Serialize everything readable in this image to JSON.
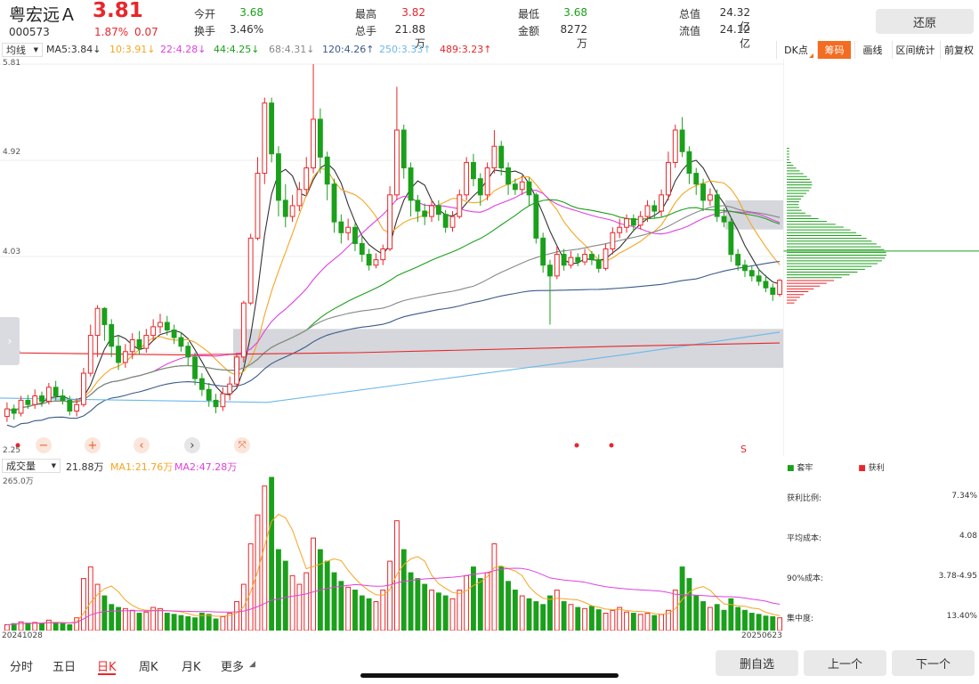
{
  "header": {
    "name": "粤宏远Ａ",
    "price": "3.81",
    "code": "000573",
    "pct": "1.87%",
    "chg": "0.07",
    "stats": [
      {
        "label": "今开",
        "value": "3.68",
        "color": "green"
      },
      {
        "label": "最高",
        "value": "3.82",
        "color": "red"
      },
      {
        "label": "最低",
        "value": "3.68",
        "color": "green"
      },
      {
        "label": "总值",
        "value": "24.32亿",
        "color": "dark"
      },
      {
        "label": "换手",
        "value": "3.46%",
        "color": "dark"
      },
      {
        "label": "总手",
        "value": "21.88万",
        "color": "dark"
      },
      {
        "label": "金额",
        "value": "8272万",
        "color": "dark"
      },
      {
        "label": "流值",
        "value": "24.12亿",
        "color": "dark"
      }
    ],
    "restore_button": "还原"
  },
  "ma_bar": {
    "selector": "均线",
    "items": [
      {
        "text": "MA5:3.84↓",
        "color": "#333333"
      },
      {
        "text": "10:3.91↓",
        "color": "#f5a623"
      },
      {
        "text": "22:4.28↓",
        "color": "#e040e0"
      },
      {
        "text": "44:4.25↓",
        "color": "#1aa01a"
      },
      {
        "text": "68:4.31↓",
        "color": "#888888"
      },
      {
        "text": "120:4.26↑",
        "color": "#3b5a8a"
      },
      {
        "text": "250:3.33↑",
        "color": "#6cb8ea"
      },
      {
        "text": "489:3.23↑",
        "color": "#e8262a"
      }
    ]
  },
  "toolbar": {
    "dk": "DK点",
    "chips": "筹码",
    "draw": "画线",
    "range": "区间统计",
    "adjust": "前复权"
  },
  "price_axis": {
    "ticks": [
      "5.81",
      "4.92",
      "4.03",
      "3.14",
      "2.25"
    ]
  },
  "chart_data": {
    "type": "candlestick",
    "ylim": [
      2.25,
      5.81
    ],
    "days": [
      {
        "open": 2.55,
        "close": 2.62,
        "high": 2.68,
        "low": 2.5
      },
      {
        "open": 2.62,
        "close": 2.58,
        "high": 2.66,
        "low": 2.52
      },
      {
        "open": 2.58,
        "close": 2.7,
        "high": 2.74,
        "low": 2.55
      },
      {
        "open": 2.7,
        "close": 2.66,
        "high": 2.75,
        "low": 2.62
      },
      {
        "open": 2.66,
        "close": 2.74,
        "high": 2.8,
        "low": 2.62
      },
      {
        "open": 2.74,
        "close": 2.69,
        "high": 2.78,
        "low": 2.64
      },
      {
        "open": 2.69,
        "close": 2.82,
        "high": 2.86,
        "low": 2.66
      },
      {
        "open": 2.82,
        "close": 2.74,
        "high": 2.88,
        "low": 2.7
      },
      {
        "open": 2.74,
        "close": 2.7,
        "high": 2.8,
        "low": 2.66
      },
      {
        "open": 2.7,
        "close": 2.6,
        "high": 2.74,
        "low": 2.56
      },
      {
        "open": 2.6,
        "close": 2.66,
        "high": 2.72,
        "low": 2.55
      },
      {
        "open": 2.66,
        "close": 2.95,
        "high": 3.0,
        "low": 2.64
      },
      {
        "open": 2.95,
        "close": 3.3,
        "high": 3.4,
        "low": 2.92
      },
      {
        "open": 3.3,
        "close": 3.55,
        "high": 3.58,
        "low": 3.1
      },
      {
        "open": 3.55,
        "close": 3.4,
        "high": 3.56,
        "low": 3.25
      },
      {
        "open": 3.4,
        "close": 3.2,
        "high": 3.45,
        "low": 3.1
      },
      {
        "open": 3.2,
        "close": 3.05,
        "high": 3.3,
        "low": 2.98
      },
      {
        "open": 3.05,
        "close": 3.15,
        "high": 3.22,
        "low": 3.0
      },
      {
        "open": 3.15,
        "close": 3.26,
        "high": 3.32,
        "low": 3.08
      },
      {
        "open": 3.26,
        "close": 3.18,
        "high": 3.34,
        "low": 3.12
      },
      {
        "open": 3.18,
        "close": 3.3,
        "high": 3.36,
        "low": 3.14
      },
      {
        "open": 3.3,
        "close": 3.38,
        "high": 3.45,
        "low": 3.25
      },
      {
        "open": 3.38,
        "close": 3.42,
        "high": 3.5,
        "low": 3.32
      },
      {
        "open": 3.42,
        "close": 3.35,
        "high": 3.48,
        "low": 3.3
      },
      {
        "open": 3.35,
        "close": 3.28,
        "high": 3.4,
        "low": 3.22
      },
      {
        "open": 3.28,
        "close": 3.2,
        "high": 3.33,
        "low": 3.15
      },
      {
        "open": 3.2,
        "close": 3.1,
        "high": 3.24,
        "low": 3.02
      },
      {
        "open": 3.1,
        "close": 2.9,
        "high": 3.14,
        "low": 2.84
      },
      {
        "open": 2.9,
        "close": 2.8,
        "high": 2.95,
        "low": 2.74
      },
      {
        "open": 2.8,
        "close": 2.7,
        "high": 2.86,
        "low": 2.64
      },
      {
        "open": 2.7,
        "close": 2.64,
        "high": 2.76,
        "low": 2.58
      },
      {
        "open": 2.64,
        "close": 2.76,
        "high": 2.82,
        "low": 2.6
      },
      {
        "open": 2.76,
        "close": 2.85,
        "high": 2.92,
        "low": 2.7
      },
      {
        "open": 2.85,
        "close": 3.1,
        "high": 3.14,
        "low": 2.82
      },
      {
        "open": 3.1,
        "close": 3.6,
        "high": 3.62,
        "low": 3.05
      },
      {
        "open": 3.6,
        "close": 4.2,
        "high": 4.24,
        "low": 3.58
      },
      {
        "open": 4.2,
        "close": 4.8,
        "high": 4.95,
        "low": 4.18
      },
      {
        "open": 4.8,
        "close": 5.45,
        "high": 5.5,
        "low": 4.7
      },
      {
        "open": 5.45,
        "close": 4.98,
        "high": 5.5,
        "low": 4.9
      },
      {
        "open": 4.98,
        "close": 4.55,
        "high": 5.05,
        "low": 4.4
      },
      {
        "open": 4.55,
        "close": 4.4,
        "high": 4.7,
        "low": 4.3
      },
      {
        "open": 4.4,
        "close": 4.5,
        "high": 4.6,
        "low": 4.35
      },
      {
        "open": 4.5,
        "close": 4.65,
        "high": 4.72,
        "low": 4.45
      },
      {
        "open": 4.65,
        "close": 4.85,
        "high": 4.95,
        "low": 4.6
      },
      {
        "open": 4.85,
        "close": 5.3,
        "high": 5.81,
        "low": 4.8
      },
      {
        "open": 5.3,
        "close": 4.95,
        "high": 5.4,
        "low": 4.8
      },
      {
        "open": 4.95,
        "close": 4.7,
        "high": 5.0,
        "low": 4.55
      },
      {
        "open": 4.7,
        "close": 4.35,
        "high": 4.75,
        "low": 4.25
      },
      {
        "open": 4.35,
        "close": 4.25,
        "high": 4.42,
        "low": 4.15
      },
      {
        "open": 4.25,
        "close": 4.3,
        "high": 4.38,
        "low": 4.18
      },
      {
        "open": 4.3,
        "close": 4.15,
        "high": 4.34,
        "low": 4.08
      },
      {
        "open": 4.15,
        "close": 4.05,
        "high": 4.22,
        "low": 3.98
      },
      {
        "open": 4.05,
        "close": 3.95,
        "high": 4.1,
        "low": 3.9
      },
      {
        "open": 3.95,
        "close": 4.0,
        "high": 4.06,
        "low": 3.92
      },
      {
        "open": 4.0,
        "close": 4.1,
        "high": 4.14,
        "low": 3.95
      },
      {
        "open": 4.1,
        "close": 4.6,
        "high": 4.68,
        "low": 4.08
      },
      {
        "open": 4.6,
        "close": 5.2,
        "high": 5.6,
        "low": 4.55
      },
      {
        "open": 5.2,
        "close": 4.85,
        "high": 5.25,
        "low": 4.75
      },
      {
        "open": 4.85,
        "close": 4.55,
        "high": 4.9,
        "low": 4.4
      },
      {
        "open": 4.55,
        "close": 4.45,
        "high": 4.6,
        "low": 4.35
      },
      {
        "open": 4.45,
        "close": 4.4,
        "high": 4.52,
        "low": 4.32
      },
      {
        "open": 4.4,
        "close": 4.5,
        "high": 4.56,
        "low": 4.35
      },
      {
        "open": 4.5,
        "close": 4.42,
        "high": 4.55,
        "low": 4.36
      },
      {
        "open": 4.42,
        "close": 4.3,
        "high": 4.46,
        "low": 4.25
      },
      {
        "open": 4.3,
        "close": 4.4,
        "high": 4.45,
        "low": 4.26
      },
      {
        "open": 4.4,
        "close": 4.6,
        "high": 4.65,
        "low": 4.38
      },
      {
        "open": 4.6,
        "close": 4.9,
        "high": 4.95,
        "low": 4.55
      },
      {
        "open": 4.9,
        "close": 4.75,
        "high": 4.98,
        "low": 4.68
      },
      {
        "open": 4.75,
        "close": 4.6,
        "high": 4.8,
        "low": 4.5
      },
      {
        "open": 4.6,
        "close": 4.85,
        "high": 4.9,
        "low": 4.55
      },
      {
        "open": 4.85,
        "close": 5.05,
        "high": 5.2,
        "low": 4.8
      },
      {
        "open": 5.05,
        "close": 4.85,
        "high": 5.1,
        "low": 4.78
      },
      {
        "open": 4.85,
        "close": 4.7,
        "high": 4.9,
        "low": 4.6
      },
      {
        "open": 4.7,
        "close": 4.65,
        "high": 4.75,
        "low": 4.6
      },
      {
        "open": 4.65,
        "close": 4.72,
        "high": 4.78,
        "low": 4.6
      },
      {
        "open": 4.72,
        "close": 4.6,
        "high": 4.76,
        "low": 4.5
      },
      {
        "open": 4.6,
        "close": 4.2,
        "high": 4.62,
        "low": 4.15
      },
      {
        "open": 4.2,
        "close": 3.95,
        "high": 4.25,
        "low": 3.88
      },
      {
        "open": 3.95,
        "close": 3.85,
        "high": 4.0,
        "low": 3.4
      },
      {
        "open": 3.85,
        "close": 4.05,
        "high": 4.12,
        "low": 3.82
      },
      {
        "open": 4.05,
        "close": 3.95,
        "high": 4.1,
        "low": 3.9
      },
      {
        "open": 3.95,
        "close": 4.02,
        "high": 4.08,
        "low": 3.92
      },
      {
        "open": 4.02,
        "close": 3.98,
        "high": 4.06,
        "low": 3.94
      },
      {
        "open": 3.98,
        "close": 4.05,
        "high": 4.1,
        "low": 3.95
      },
      {
        "open": 4.05,
        "close": 4.0,
        "high": 4.08,
        "low": 3.95
      },
      {
        "open": 4.0,
        "close": 3.92,
        "high": 4.05,
        "low": 3.88
      },
      {
        "open": 3.92,
        "close": 4.1,
        "high": 4.15,
        "low": 3.9
      },
      {
        "open": 4.1,
        "close": 4.25,
        "high": 4.3,
        "low": 4.05
      },
      {
        "open": 4.25,
        "close": 4.3,
        "high": 4.38,
        "low": 4.2
      },
      {
        "open": 4.3,
        "close": 4.38,
        "high": 4.42,
        "low": 4.25
      },
      {
        "open": 4.38,
        "close": 4.32,
        "high": 4.42,
        "low": 4.26
      },
      {
        "open": 4.32,
        "close": 4.4,
        "high": 4.45,
        "low": 4.28
      },
      {
        "open": 4.4,
        "close": 4.5,
        "high": 4.55,
        "low": 4.35
      },
      {
        "open": 4.5,
        "close": 4.45,
        "high": 4.55,
        "low": 4.38
      },
      {
        "open": 4.45,
        "close": 4.6,
        "high": 4.65,
        "low": 4.4
      },
      {
        "open": 4.6,
        "close": 4.9,
        "high": 5.0,
        "low": 4.55
      },
      {
        "open": 4.9,
        "close": 5.2,
        "high": 5.25,
        "low": 4.85
      },
      {
        "open": 5.2,
        "close": 5.0,
        "high": 5.32,
        "low": 4.95
      },
      {
        "open": 5.0,
        "close": 4.8,
        "high": 5.05,
        "low": 4.7
      },
      {
        "open": 4.8,
        "close": 4.7,
        "high": 4.85,
        "low": 4.6
      },
      {
        "open": 4.7,
        "close": 4.55,
        "high": 4.75,
        "low": 4.45
      },
      {
        "open": 4.55,
        "close": 4.6,
        "high": 4.66,
        "low": 4.5
      },
      {
        "open": 4.6,
        "close": 4.4,
        "high": 4.65,
        "low": 4.35
      },
      {
        "open": 4.4,
        "close": 4.35,
        "high": 4.48,
        "low": 4.3
      },
      {
        "open": 4.35,
        "close": 4.05,
        "high": 4.4,
        "low": 3.98
      },
      {
        "open": 4.05,
        "close": 3.95,
        "high": 4.1,
        "low": 3.9
      },
      {
        "open": 3.95,
        "close": 3.9,
        "high": 4.0,
        "low": 3.84
      },
      {
        "open": 3.9,
        "close": 3.85,
        "high": 3.95,
        "low": 3.8
      },
      {
        "open": 3.85,
        "close": 3.8,
        "high": 3.92,
        "low": 3.76
      },
      {
        "open": 3.8,
        "close": 3.74,
        "high": 3.86,
        "low": 3.7
      },
      {
        "open": 3.74,
        "close": 3.68,
        "high": 3.78,
        "low": 3.62
      },
      {
        "open": 3.68,
        "close": 3.81,
        "high": 3.82,
        "low": 3.66
      }
    ],
    "volume_ylim": [
      0,
      265.0
    ],
    "volumes": [
      10,
      12,
      15,
      13,
      14,
      12,
      18,
      14,
      12,
      10,
      22,
      90,
      110,
      80,
      60,
      45,
      40,
      38,
      35,
      30,
      32,
      40,
      38,
      30,
      28,
      26,
      24,
      22,
      30,
      28,
      20,
      24,
      30,
      50,
      80,
      150,
      200,
      250,
      265,
      140,
      120,
      95,
      80,
      100,
      160,
      140,
      120,
      100,
      85,
      75,
      70,
      60,
      55,
      50,
      70,
      120,
      190,
      140,
      100,
      90,
      80,
      70,
      65,
      60,
      55,
      70,
      95,
      110,
      90,
      100,
      150,
      110,
      85,
      70,
      60,
      55,
      50,
      45,
      60,
      70,
      50,
      45,
      40,
      38,
      42,
      36,
      30,
      35,
      40,
      32,
      30,
      28,
      30,
      26,
      28,
      35,
      70,
      110,
      90,
      60,
      50,
      40,
      45,
      35,
      55,
      40,
      35,
      30,
      28,
      25,
      24,
      22
    ],
    "x_start": "20241028",
    "x_end": "20250623"
  },
  "volume_bar": {
    "selector": "成交量",
    "value": "21.88万",
    "ma1": "MA1:21.76万",
    "ma2": "MA2:47.28万",
    "ymax": "265.0万"
  },
  "side_panel": {
    "legend_trapped": "套牢",
    "legend_profit": "获利",
    "rows": [
      {
        "label": "获利比例:",
        "value": "7.34%"
      },
      {
        "label": "平均成本:",
        "value": "4.08"
      },
      {
        "label": "90%成本:",
        "value": "3.78-4.95"
      },
      {
        "label": "集中度:",
        "value": "13.40%"
      }
    ]
  },
  "bottom_tabs": [
    {
      "label": "分时",
      "active": false
    },
    {
      "label": "五日",
      "active": false
    },
    {
      "label": "日K",
      "active": true
    },
    {
      "label": "周K",
      "active": false
    },
    {
      "label": "月K",
      "active": false
    },
    {
      "label": "更多",
      "active": false
    }
  ],
  "bottom_buttons": {
    "remove_watch": "删自选",
    "prev": "上一个",
    "next": "下一个"
  },
  "colors": {
    "up": "#e8262a",
    "down": "#1aa01a"
  },
  "chart_nav_icons": [
    "minus-icon",
    "plus-icon",
    "chevron-left-icon",
    "chevron-right-icon",
    "collapse-icon"
  ],
  "chart_marker": "S",
  "side_tab_icon": "chevron-right-icon"
}
